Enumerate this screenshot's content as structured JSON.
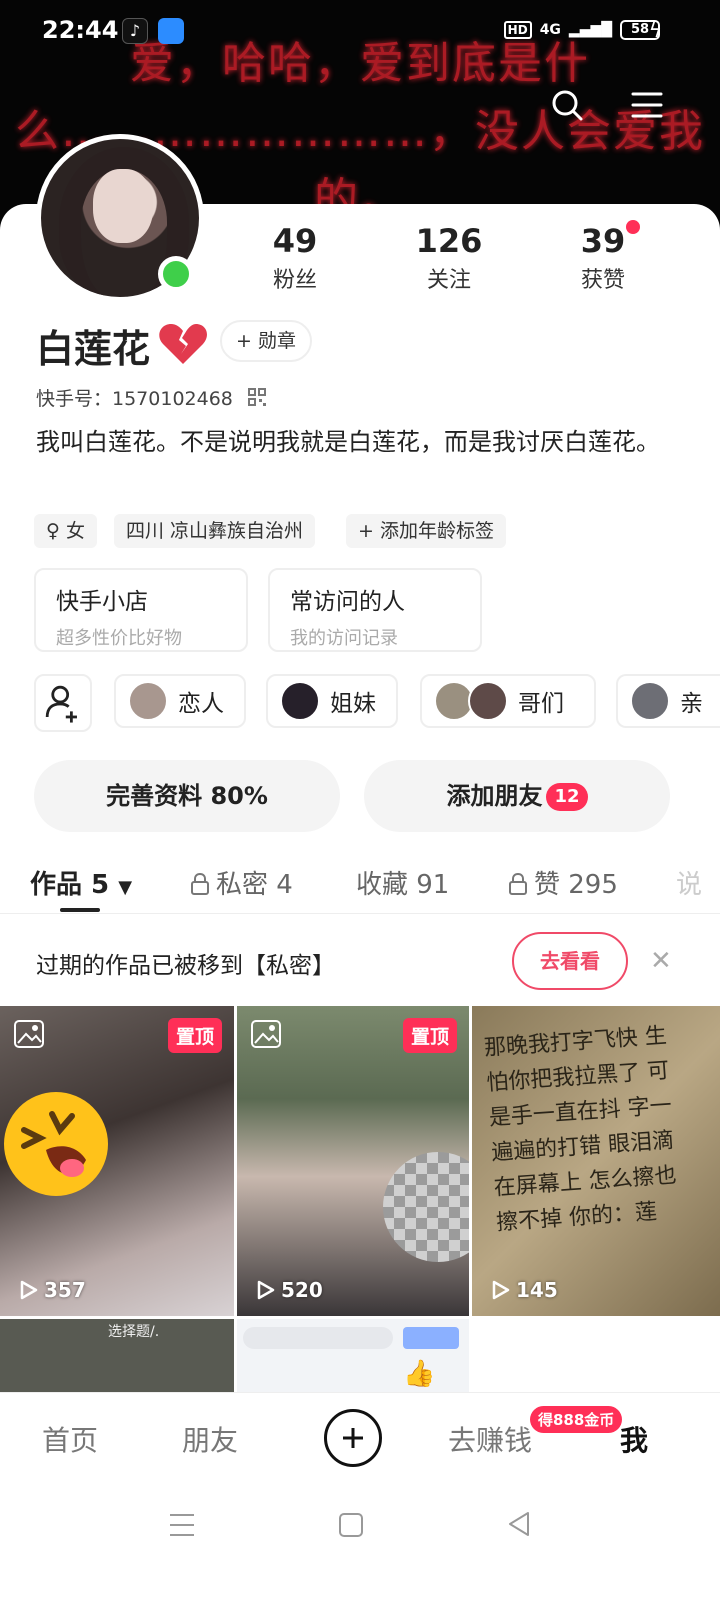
{
  "status_bar": {
    "time": "22:44",
    "network": "4G",
    "battery": "58"
  },
  "banner": {
    "text": "爱，哈哈，爱到底是什么……………………，没人会爱我的。"
  },
  "profile": {
    "name": "白莲花",
    "stats": [
      {
        "value": "49",
        "label": "粉丝"
      },
      {
        "value": "126",
        "label": "关注"
      },
      {
        "value": "39",
        "label": "获赞"
      }
    ],
    "badge_label": "+ 勋章",
    "kuaishou_id": "快手号：1570102468",
    "bio": "我叫白莲花。不是说明我就是白莲花，而是我讨厌白莲花。",
    "tags": [
      "♀ 女",
      "四川 凉山彝族自治州",
      "+ 添加年龄标签"
    ]
  },
  "boxes": [
    {
      "title": "快手小店",
      "subtitle": "超多性价比好物"
    },
    {
      "title": "常访问的人",
      "subtitle": "我的访问记录"
    }
  ],
  "relations": [
    "恋人",
    "姐妹",
    "哥们",
    "亲"
  ],
  "actions": {
    "complete_profile": "完善资料 80%",
    "add_friend": "添加朋友",
    "add_friend_count": "12"
  },
  "tabs": [
    {
      "label": "作品 5",
      "active": true
    },
    {
      "label": "私密 4",
      "locked": true
    },
    {
      "label": "收藏 91"
    },
    {
      "label": "赞 295",
      "locked": true
    },
    {
      "label": "说"
    }
  ],
  "notice": {
    "text": "过期的作品已被移到【私密】",
    "button": "去看看"
  },
  "grid": [
    {
      "pinned": "置顶",
      "plays": "357"
    },
    {
      "pinned": "置顶",
      "plays": "520"
    },
    {
      "plays": "145",
      "handwriting": "那晚我打字飞快 生怕你把我拉黑了 可是手一直在抖 字一遍遍的打错 眼泪滴在屏幕上 怎么擦也擦不掉 你的：莲"
    },
    {
      "caption": "选择题/."
    },
    {
      "caption": ""
    }
  ],
  "bottom_nav": {
    "home": "首页",
    "friends": "朋友",
    "earn": "去赚钱",
    "me": "我",
    "coin_badge": "得888金币"
  },
  "colors": {
    "accent": "#ff2f57",
    "online": "#3fcf4a"
  }
}
